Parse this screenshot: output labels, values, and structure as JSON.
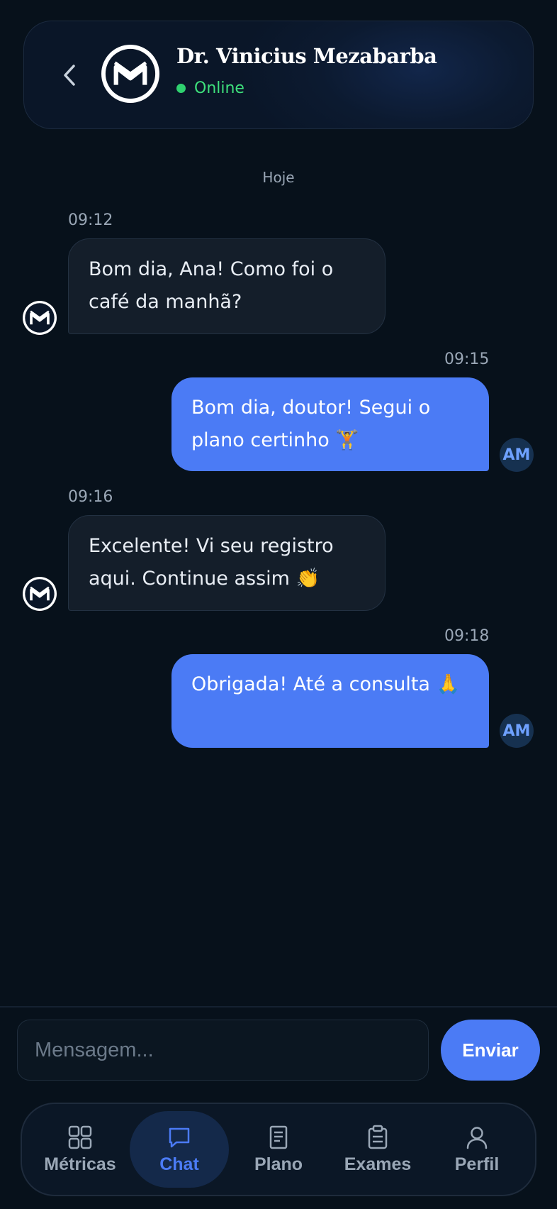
{
  "header": {
    "doctor_name": "Dr. Vinicius Mezabarba",
    "status": "Online",
    "back_icon": "chevron-left-icon",
    "logo_icon": "m-logo-icon"
  },
  "chat": {
    "day_label": "Hoje",
    "messages": [
      {
        "time": "09:12",
        "text": "Bom dia, Ana! Como foi o café da manhã?",
        "from": "doctor"
      },
      {
        "time": "09:15",
        "text": "Bom dia, doutor! Segui o plano certinho 🏋",
        "from": "patient"
      },
      {
        "time": "09:16",
        "text": "Excelente! Vi seu registro aqui. Continue assim 👏",
        "from": "doctor"
      },
      {
        "time": "09:18",
        "text": "Obrigada! Até a consulta 🙏",
        "from": "patient"
      }
    ],
    "patient_initials": "AM"
  },
  "composer": {
    "placeholder": "Mensagem...",
    "send_label": "Enviar"
  },
  "nav": {
    "items": [
      {
        "label": "Métricas",
        "icon": "grid-icon"
      },
      {
        "label": "Chat",
        "icon": "chat-icon",
        "active": true
      },
      {
        "label": "Plano",
        "icon": "document-icon"
      },
      {
        "label": "Exames",
        "icon": "clipboard-icon"
      },
      {
        "label": "Perfil",
        "icon": "user-icon"
      }
    ]
  },
  "colors": {
    "background": "#07111b",
    "accent": "#4b7bf5",
    "online": "#2fd16f"
  }
}
